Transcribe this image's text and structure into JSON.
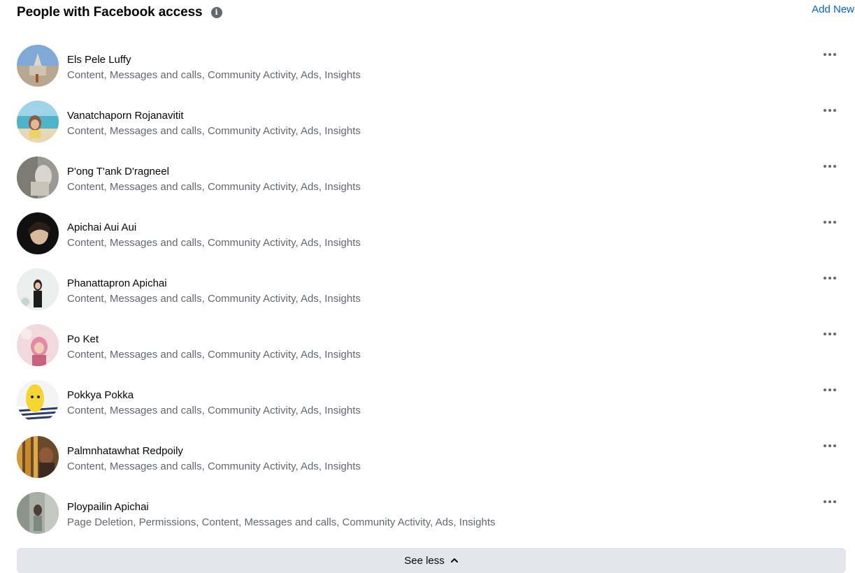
{
  "header": {
    "title": "People with Facebook access",
    "add_new_label": "Add New"
  },
  "people": [
    {
      "name": "Els Pele Luffy",
      "permissions": "Content, Messages and calls, Community Activity, Ads, Insights"
    },
    {
      "name": "Vanatchaporn Rojanavitit",
      "permissions": "Content, Messages and calls, Community Activity, Ads, Insights"
    },
    {
      "name": "P'ong T'ank D'ragneel",
      "permissions": "Content, Messages and calls, Community Activity, Ads, Insights"
    },
    {
      "name": "Apichai Aui Aui",
      "permissions": "Content, Messages and calls, Community Activity, Ads, Insights"
    },
    {
      "name": "Phanattapron Apichai",
      "permissions": "Content, Messages and calls, Community Activity, Ads, Insights"
    },
    {
      "name": "Po Ket",
      "permissions": "Content, Messages and calls, Community Activity, Ads, Insights"
    },
    {
      "name": "Pokkya Pokka",
      "permissions": "Content, Messages and calls, Community Activity, Ads, Insights"
    },
    {
      "name": "Palmnhatawhat Redpoily",
      "permissions": "Content, Messages and calls, Community Activity, Ads, Insights"
    },
    {
      "name": "Ploypailin Apichai",
      "permissions": "Page Deletion, Permissions, Content, Messages and calls, Community Activity, Ads, Insights"
    }
  ],
  "footer": {
    "see_less_label": "See less"
  },
  "colors": {
    "accent": "#0064d1",
    "secondary_text": "#65676b",
    "button_bg": "#e4e6eb"
  }
}
